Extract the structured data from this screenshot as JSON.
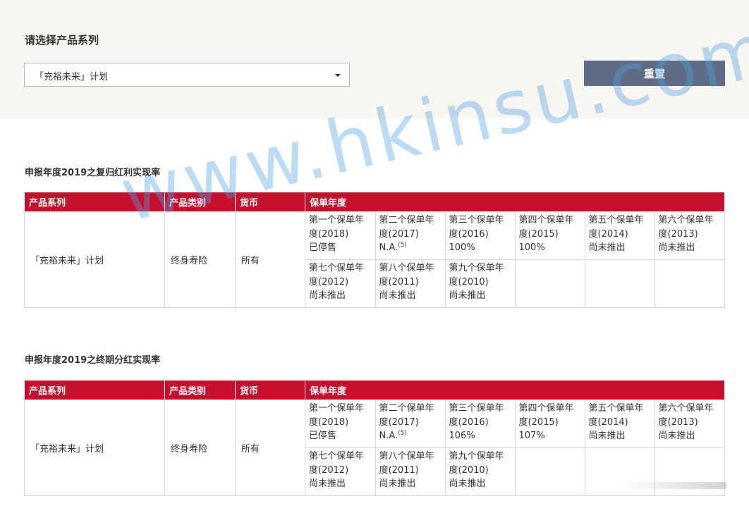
{
  "selector": {
    "label": "请选择产品系列",
    "value": "「充裕未来」计划",
    "reset_label": "重置"
  },
  "sections": [
    {
      "title": "申报年度2019之复归红利实现率",
      "headers": [
        "产品系列",
        "产品类别",
        "货币",
        "保单年度"
      ],
      "product": "「充裕未来」计划",
      "category": "终身寿险",
      "currency": "所有",
      "years": [
        {
          "l1": "第一个保单年",
          "l2": "度(2018)",
          "v": "已停售",
          "sup": ""
        },
        {
          "l1": "第二个保单年",
          "l2": "度(2017)",
          "v": "N.A.",
          "sup": "(5)"
        },
        {
          "l1": "第三个保单年",
          "l2": "度(2016)",
          "v": "100%",
          "sup": ""
        },
        {
          "l1": "第四个保单年",
          "l2": "度(2015)",
          "v": "100%",
          "sup": ""
        },
        {
          "l1": "第五个保单年",
          "l2": "度(2014)",
          "v": "尚未推出",
          "sup": ""
        },
        {
          "l1": "第六个保单年",
          "l2": "度(2013)",
          "v": "尚未推出",
          "sup": ""
        },
        {
          "l1": "第七个保单年",
          "l2": "度(2012)",
          "v": "尚未推出",
          "sup": ""
        },
        {
          "l1": "第八个保单年",
          "l2": "度(2011)",
          "v": "尚未推出",
          "sup": ""
        },
        {
          "l1": "第九个保单年",
          "l2": "度(2010)",
          "v": "尚未推出",
          "sup": ""
        }
      ]
    },
    {
      "title": "申报年度2019之终期分红实现率",
      "headers": [
        "产品系列",
        "产品类别",
        "货币",
        "保单年度"
      ],
      "product": "「充裕未来」计划",
      "category": "终身寿险",
      "currency": "所有",
      "years": [
        {
          "l1": "第一个保单年",
          "l2": "度(2018)",
          "v": "已停售",
          "sup": ""
        },
        {
          "l1": "第二个保单年",
          "l2": "度(2017)",
          "v": "N.A.",
          "sup": "(5)"
        },
        {
          "l1": "第三个保单年",
          "l2": "度(2016)",
          "v": "106%",
          "sup": ""
        },
        {
          "l1": "第四个保单年",
          "l2": "度(2015)",
          "v": "107%",
          "sup": ""
        },
        {
          "l1": "第五个保单年",
          "l2": "度(2014)",
          "v": "尚未推出",
          "sup": ""
        },
        {
          "l1": "第六个保单年",
          "l2": "度(2013)",
          "v": "尚未推出",
          "sup": ""
        },
        {
          "l1": "第七个保单年",
          "l2": "度(2012)",
          "v": "尚未推出",
          "sup": ""
        },
        {
          "l1": "第八个保单年",
          "l2": "度(2011)",
          "v": "尚未推出",
          "sup": ""
        },
        {
          "l1": "第九个保单年",
          "l2": "度(2010)",
          "v": "尚未推出",
          "sup": ""
        }
      ]
    }
  ],
  "watermark": "www.hkinsu.com",
  "colors": {
    "header_red": "#c8102e",
    "button": "#5e6c85",
    "top_bg": "#f8f6f1"
  }
}
